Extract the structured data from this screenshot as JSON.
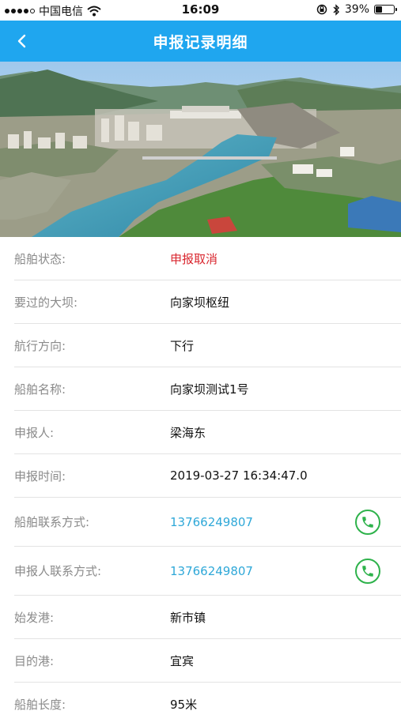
{
  "status_bar": {
    "carrier": "中国电信",
    "time": "16:09",
    "battery_percent": "39%",
    "battery_level": 0.39,
    "signal_bars": 4
  },
  "nav": {
    "title": "申报记录明细",
    "back_icon": "chevron-left-icon"
  },
  "colors": {
    "nav_background": "#1fa6ef",
    "status_red": "#d9262e",
    "phone_blue": "#2fa8d8",
    "call_green": "#2eb24b"
  },
  "details": [
    {
      "label": "船舶状态:",
      "value": "申报取消",
      "kind": "status"
    },
    {
      "label": "要过的大坝:",
      "value": "向家坝枢纽",
      "kind": "text"
    },
    {
      "label": "航行方向:",
      "value": "下行",
      "kind": "text"
    },
    {
      "label": "船舶名称:",
      "value": "向家坝测试1号",
      "kind": "text"
    },
    {
      "label": "申报人:",
      "value": "梁海东",
      "kind": "text"
    },
    {
      "label": "申报时间:",
      "value": "2019-03-27 16:34:47.0",
      "kind": "text"
    },
    {
      "label": "船舶联系方式:",
      "value": "13766249807",
      "kind": "phone",
      "action_icon": "phone-call-icon"
    },
    {
      "label": "申报人联系方式:",
      "value": "13766249807",
      "kind": "phone",
      "action_icon": "phone-call-icon"
    },
    {
      "label": "始发港:",
      "value": "新市镇",
      "kind": "text"
    },
    {
      "label": "目的港:",
      "value": "宜宾",
      "kind": "text"
    },
    {
      "label": "船舶长度:",
      "value": "95米",
      "kind": "text"
    }
  ]
}
